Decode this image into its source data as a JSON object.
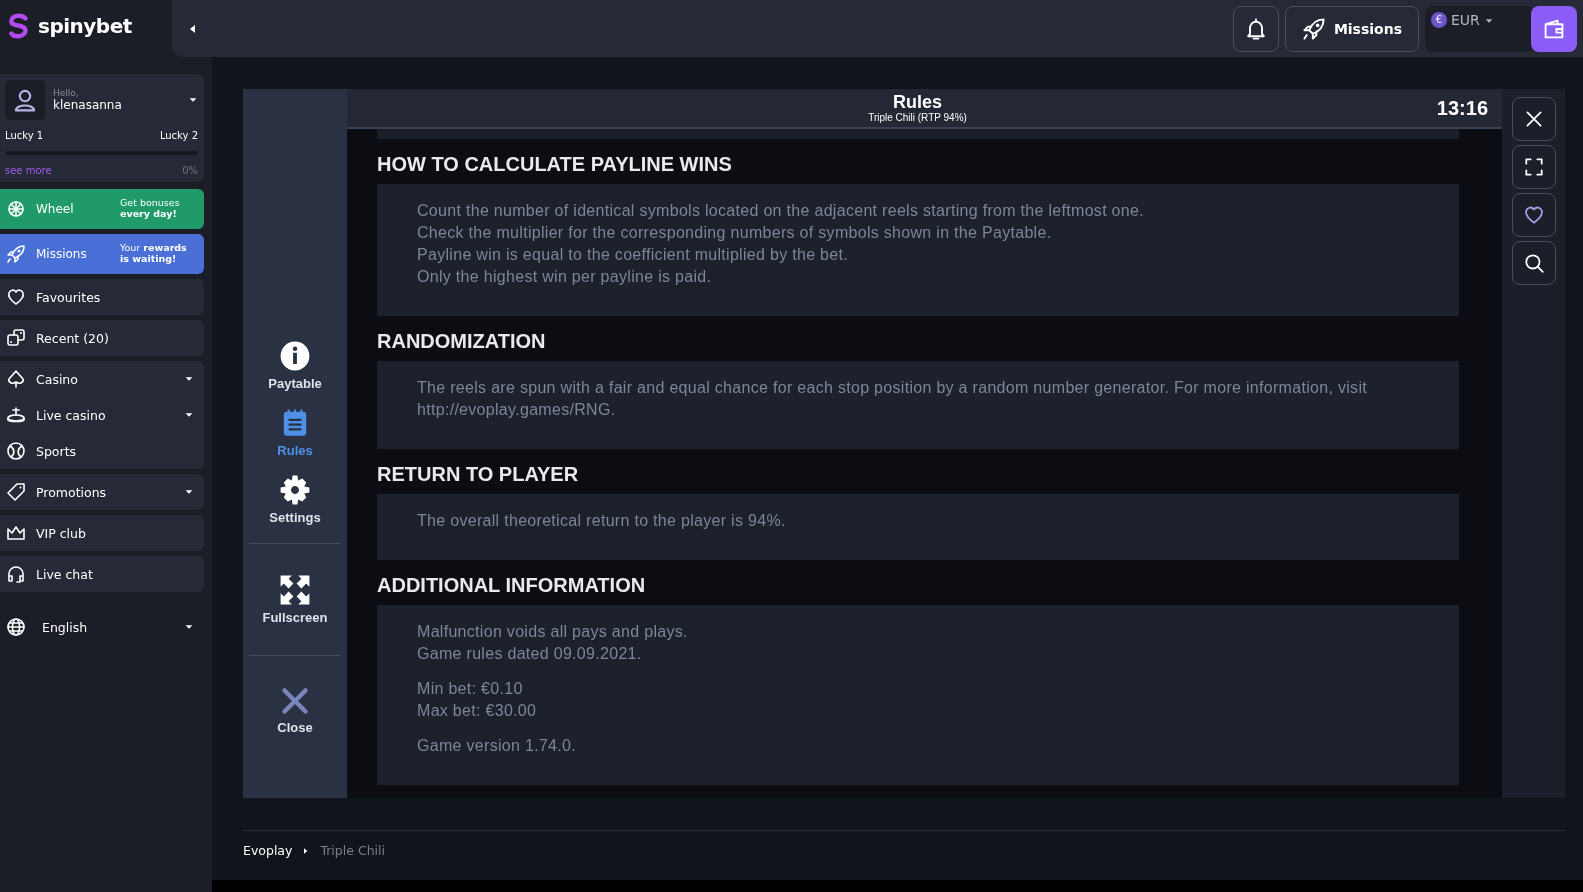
{
  "brand": {
    "name": "spinybet"
  },
  "user": {
    "greeting": "Hello,",
    "username": "klenasanna",
    "level_from": "Lucky 1",
    "level_to": "Lucky 2",
    "level": 0,
    "see_more": "see more",
    "percent": "0%"
  },
  "promos": [
    {
      "kind": "wheel",
      "label": "Wheel",
      "text": "Get bonuses **every day!**"
    },
    {
      "kind": "missions",
      "label": "Missions",
      "text": "Your **rewards is waiting!**"
    }
  ],
  "nav_groups": [
    [
      {
        "kind": "heart",
        "label": "Favourites",
        "dropdown": false
      }
    ],
    [
      {
        "kind": "dice",
        "label": "Recent (20)",
        "dropdown": false
      }
    ],
    [
      {
        "kind": "spade",
        "label": "Casino",
        "dropdown": true
      },
      {
        "kind": "roulette",
        "label": "Live casino",
        "dropdown": true
      },
      {
        "kind": "ball",
        "label": "Sports",
        "dropdown": false
      }
    ],
    [
      {
        "kind": "tag",
        "label": "Promotions",
        "dropdown": true
      }
    ],
    [
      {
        "kind": "crown",
        "label": "VIP club",
        "dropdown": false
      }
    ],
    [
      {
        "kind": "headset",
        "label": "Live chat",
        "dropdown": false
      }
    ]
  ],
  "language": {
    "label": "English"
  },
  "topbar": {
    "missions": "Missions",
    "currency_symbol": "€",
    "currency": "EUR"
  },
  "game": {
    "title": "Rules",
    "subtitle": "Triple Chili (RTP 94%)",
    "time": "13:16",
    "menu": [
      {
        "kind": "info",
        "label": "Paytable",
        "selected": false
      },
      {
        "kind": "rules",
        "label": "Rules",
        "selected": true
      },
      {
        "kind": "gear",
        "label": "Settings",
        "selected": false
      }
    ],
    "actions": [
      {
        "kind": "fullscreen",
        "label": "Fullscreen"
      },
      {
        "kind": "close",
        "label": "Close"
      }
    ],
    "sections": [
      {
        "heading": "HOW TO CALCULATE PAYLINE WINS",
        "paragraphs": [
          [
            "Count the number of identical symbols located on the adjacent reels starting from the leftmost one.",
            "Check the multiplier for the corresponding numbers of symbols shown in the Paytable.",
            "Payline win is equal to the coefficient multiplied by the bet.",
            "Only the highest win per payline is paid."
          ]
        ]
      },
      {
        "heading": "RANDOMIZATION",
        "paragraphs": [
          [
            "The reels are spun with a fair and equal chance for each stop position by a random number generator. For more information, visit http://evoplay.games/RNG."
          ]
        ]
      },
      {
        "heading": "RETURN TO PLAYER",
        "paragraphs": [
          [
            "The overall theoretical return to the player is 94%."
          ]
        ]
      },
      {
        "heading": "ADDITIONAL INFORMATION",
        "paragraphs": [
          [
            "Malfunction voids all pays and plays.",
            "Game rules dated 09.09.2021."
          ],
          [
            "Min bet: €0.10",
            "Max bet: €30.00"
          ],
          [
            "Game version 1.74.0."
          ]
        ]
      }
    ]
  },
  "breadcrumb": [
    "Evoplay",
    "Triple Chili"
  ]
}
